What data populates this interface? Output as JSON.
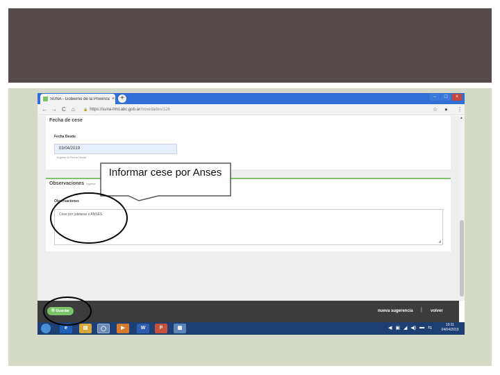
{
  "colors": {
    "top_band": "#554b4a",
    "bottom_band": "#d5d9c7",
    "chrome_tabbar": "#2f6fd6",
    "accent_green": "#7cc36a",
    "footer_dark": "#3c3c3c",
    "taskbar": "#1e3f73"
  },
  "browser": {
    "tab_title": "SUNA - Gobierno de la Provincia",
    "tab_close": "×",
    "new_tab": "+",
    "window_controls": {
      "minimize": "–",
      "maximize": "□",
      "close": "×"
    },
    "nav": {
      "back": "←",
      "forward": "→",
      "reload": "C",
      "home": "⌂"
    },
    "url_lock": "🔒",
    "url_host": "https://suna-hml.abc.gob.ar",
    "url_path": "/novedades/126",
    "star_icon": "☆",
    "account_icon": "●",
    "menu_icon": "⋮"
  },
  "form": {
    "section_fecha": {
      "title": "Fecha de cese",
      "field_label": "Fecha Desde",
      "field_value": "03/04/2019",
      "help": "Ingrese la Fecha Desde"
    },
    "section_obs": {
      "title": "Observaciones",
      "hint": "Ingrese",
      "field_label": "Observaciones",
      "field_value": "Cese por jubilarse x ANSES",
      "resize": "◢"
    }
  },
  "footer": {
    "save_icon": "🖫",
    "save_label": "Guardar",
    "sugerencia_label": "nueva sugerencia",
    "separator": "|",
    "volver_label": "volver"
  },
  "taskbar": {
    "apps": [
      "e",
      "▤",
      "◯",
      "▶",
      "W",
      "P",
      "▦"
    ],
    "tray": [
      "◀",
      "▣",
      "◢",
      "◀)",
      "▬",
      "⇆"
    ],
    "clock_time": "10:11",
    "clock_date": "04/04/2019"
  },
  "annotation": {
    "callout_text": "Informar cese por Anses"
  }
}
